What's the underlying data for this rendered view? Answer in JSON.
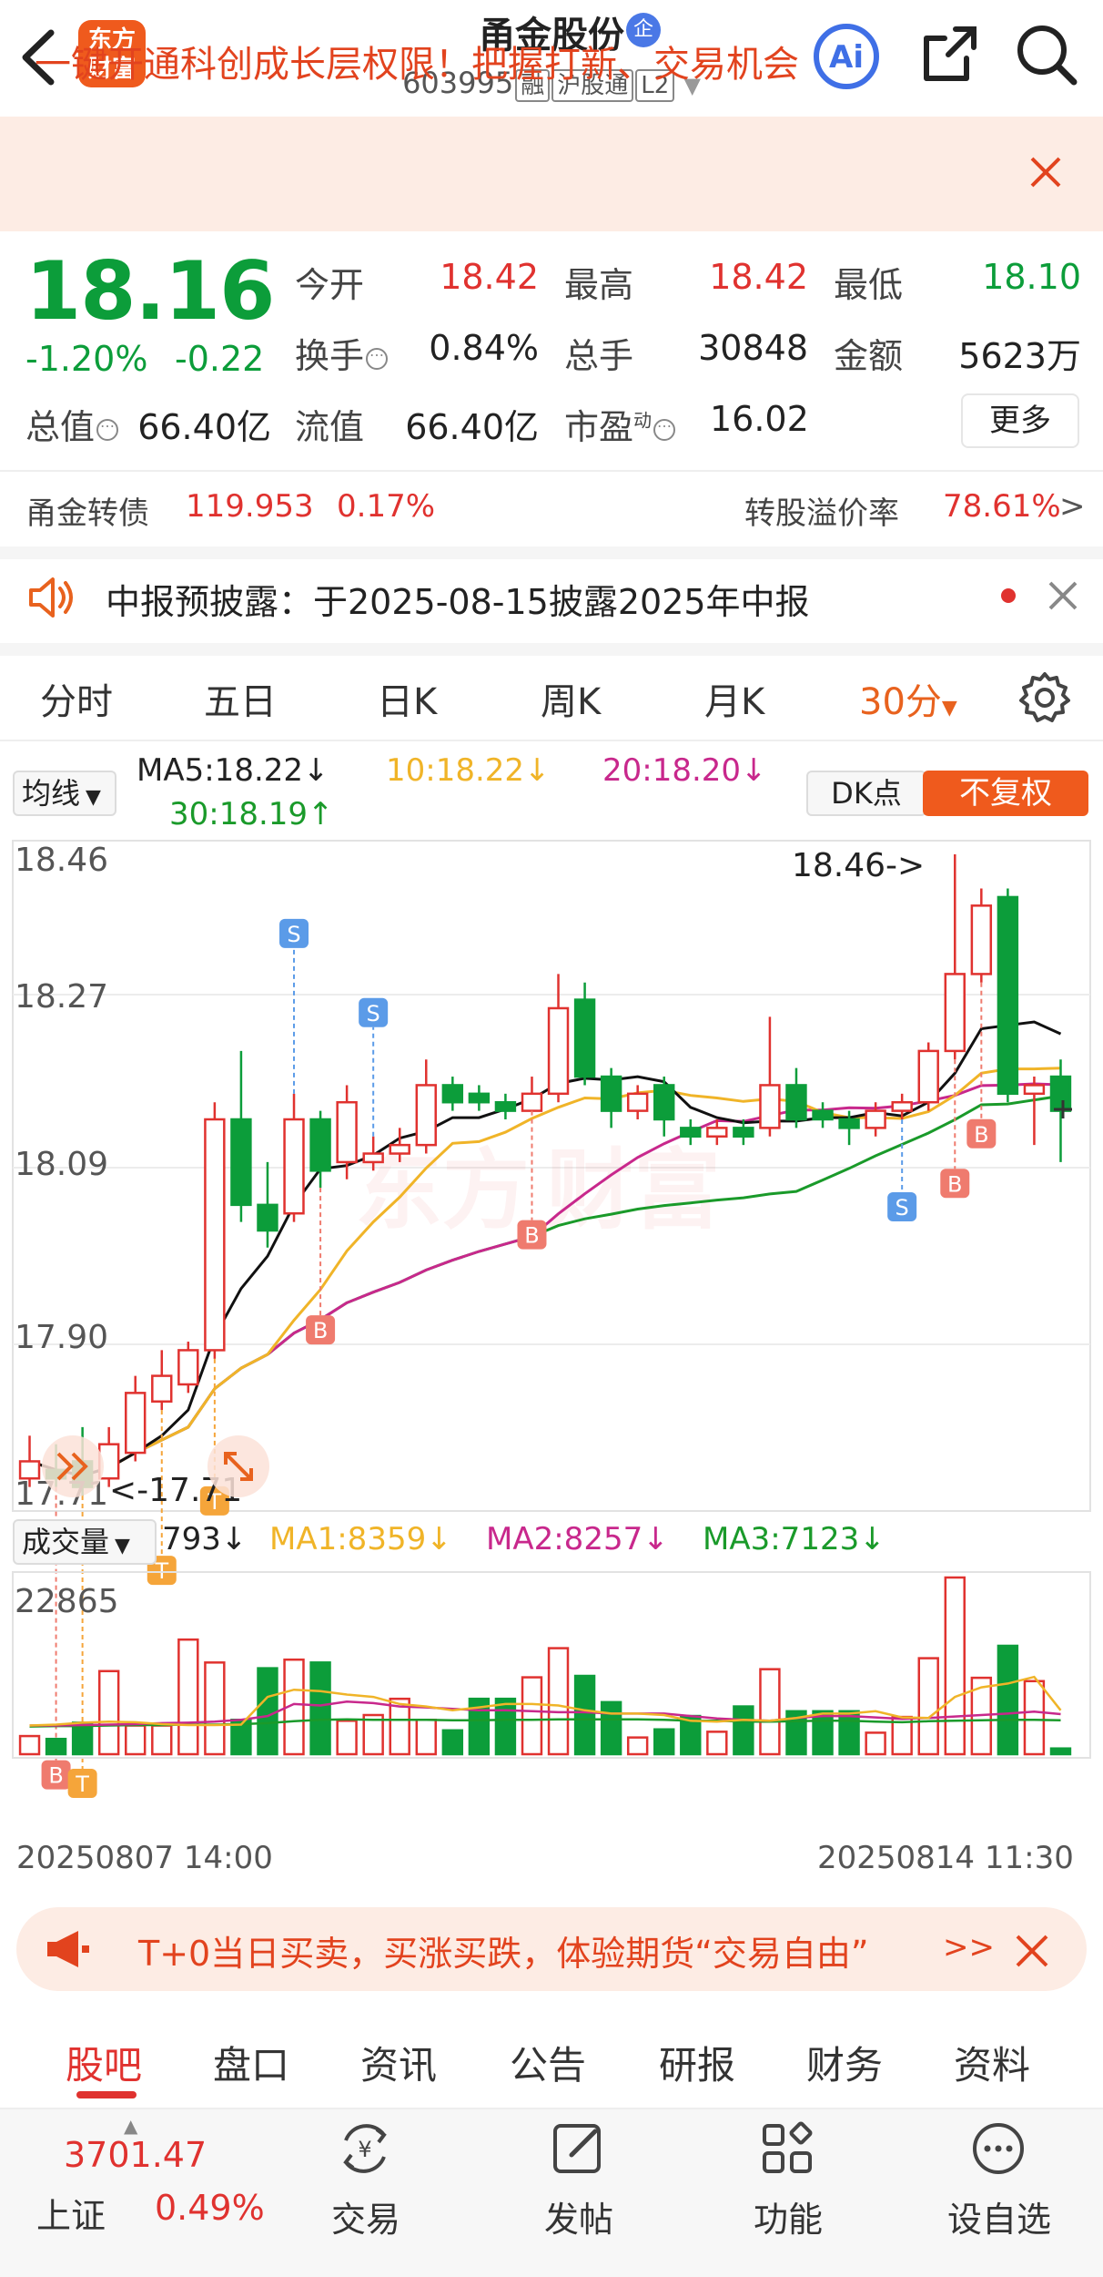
{
  "header": {
    "logo": [
      "东方",
      "财富"
    ],
    "stock_name": "甬金股份",
    "qi_badge": "企",
    "code": "603995",
    "tags": [
      "融",
      "沪股通",
      "L2"
    ],
    "ai_label": "Ai"
  },
  "banner": {
    "text": "一键开通科创成长层权限！把握打新、交易机会"
  },
  "quote": {
    "price": "18.16",
    "change_pct": "-1.20%",
    "change_abs": "-0.22",
    "fields": [
      {
        "label": "今开",
        "value": "18.42",
        "color": "red"
      },
      {
        "label": "最高",
        "value": "18.42",
        "color": "red"
      },
      {
        "label": "最低",
        "value": "18.10",
        "color": "green"
      },
      {
        "label": "换手",
        "value": "0.84%",
        "color": "dark"
      },
      {
        "label": "总手",
        "value": "30848",
        "color": "dark"
      },
      {
        "label": "金额",
        "value": "5623万",
        "color": "dark"
      },
      {
        "label": "总值",
        "value": "66.40亿",
        "color": "dark"
      },
      {
        "label": "流值",
        "value": "66.40亿",
        "color": "dark"
      },
      {
        "label": "市盈",
        "value": "16.02",
        "color": "dark"
      }
    ],
    "pe_superscript": "动",
    "more_label": "更多"
  },
  "bond": {
    "label": "甬金转债",
    "price": "119.953",
    "pct": "0.17%",
    "premium_label": "转股溢价率",
    "premium_value": "78.61%",
    "arrow": ">"
  },
  "notice": {
    "text": "中报预披露：于2025-08-15披露2025年中报"
  },
  "period_tabs": [
    "分时",
    "五日",
    "日K",
    "周K",
    "月K",
    "30分"
  ],
  "active_period": "30分",
  "ma_bar": {
    "select": "均线",
    "ma5": "MA5:18.22↓",
    "ma10": "10:18.22↓",
    "ma20": "20:18.20↓",
    "ma30": "30:18.19↑",
    "dk": "DK点",
    "fq": "不复权"
  },
  "chart_labels": {
    "y_ticks": [
      "18.46",
      "18.27",
      "18.09",
      "17.90",
      "17.71"
    ],
    "high_marker": "18.46->",
    "low_marker": "<-17.71",
    "volume_max": "22865"
  },
  "volume_bar": {
    "select": "成交量",
    "current": "793↓",
    "ma1": "MA1:8359↓",
    "ma2": "MA2:8257↓",
    "ma3": "MA3:7123↓"
  },
  "dates": {
    "start": "20250807 14:00",
    "end": "20250814 11:30"
  },
  "ad": {
    "text": "T+0当日买卖，买涨买跌，体验期货“交易自由”",
    "more": ">>"
  },
  "bottom_tabs": [
    "股吧",
    "盘口",
    "资讯",
    "公告",
    "研报",
    "财务",
    "资料"
  ],
  "active_bottom_tab": "股吧",
  "toolbar": {
    "index_value": "3701.47",
    "index_name": "上证",
    "index_pct": "0.49%",
    "items": [
      "交易",
      "发帖",
      "功能",
      "设自选"
    ]
  },
  "colors": {
    "up": "#e0322f",
    "down": "#0c9d3a",
    "accent": "#ef5a1d",
    "ma5": "#111111",
    "ma10": "#f0b428",
    "ma20": "#c8288c",
    "ma30": "#1a9a2a"
  },
  "chart_data": {
    "type": "candlestick",
    "interval": "30min",
    "ylim": [
      17.71,
      18.46
    ],
    "candles": [
      {
        "o": 17.73,
        "c": 17.75,
        "h": 17.78,
        "l": 17.72
      },
      {
        "o": 17.74,
        "c": 17.73,
        "h": 17.77,
        "l": 17.72
      },
      {
        "o": 17.75,
        "c": 17.72,
        "h": 17.79,
        "l": 17.71
      },
      {
        "o": 17.73,
        "c": 17.77,
        "h": 17.79,
        "l": 17.72
      },
      {
        "o": 17.76,
        "c": 17.83,
        "h": 17.85,
        "l": 17.75
      },
      {
        "o": 17.82,
        "c": 17.85,
        "h": 17.88,
        "l": 17.81
      },
      {
        "o": 17.84,
        "c": 17.88,
        "h": 17.89,
        "l": 17.83
      },
      {
        "o": 17.88,
        "c": 18.15,
        "h": 18.17,
        "l": 17.87
      },
      {
        "o": 18.15,
        "c": 18.05,
        "h": 18.23,
        "l": 18.03
      },
      {
        "o": 18.05,
        "c": 18.02,
        "h": 18.1,
        "l": 18.0
      },
      {
        "o": 18.04,
        "c": 18.15,
        "h": 18.18,
        "l": 18.03
      },
      {
        "o": 18.15,
        "c": 18.09,
        "h": 18.16,
        "l": 18.07
      },
      {
        "o": 18.1,
        "c": 18.17,
        "h": 18.19,
        "l": 18.08
      },
      {
        "o": 18.1,
        "c": 18.11,
        "h": 18.13,
        "l": 18.09
      },
      {
        "o": 18.11,
        "c": 18.12,
        "h": 18.14,
        "l": 18.1
      },
      {
        "o": 18.12,
        "c": 18.19,
        "h": 18.22,
        "l": 18.11
      },
      {
        "o": 18.19,
        "c": 18.17,
        "h": 18.2,
        "l": 18.16
      },
      {
        "o": 18.18,
        "c": 18.17,
        "h": 18.19,
        "l": 18.16
      },
      {
        "o": 18.17,
        "c": 18.16,
        "h": 18.18,
        "l": 18.15
      },
      {
        "o": 18.16,
        "c": 18.18,
        "h": 18.2,
        "l": 18.16
      },
      {
        "o": 18.18,
        "c": 18.28,
        "h": 18.32,
        "l": 18.17
      },
      {
        "o": 18.29,
        "c": 18.2,
        "h": 18.31,
        "l": 18.19
      },
      {
        "o": 18.2,
        "c": 18.16,
        "h": 18.21,
        "l": 18.14
      },
      {
        "o": 18.16,
        "c": 18.18,
        "h": 18.19,
        "l": 18.15
      },
      {
        "o": 18.19,
        "c": 18.15,
        "h": 18.2,
        "l": 18.13
      },
      {
        "o": 18.14,
        "c": 18.13,
        "h": 18.15,
        "l": 18.12
      },
      {
        "o": 18.13,
        "c": 18.14,
        "h": 18.15,
        "l": 18.12
      },
      {
        "o": 18.14,
        "c": 18.13,
        "h": 18.15,
        "l": 18.12
      },
      {
        "o": 18.14,
        "c": 18.19,
        "h": 18.27,
        "l": 18.13
      },
      {
        "o": 18.19,
        "c": 18.15,
        "h": 18.21,
        "l": 18.14
      },
      {
        "o": 18.16,
        "c": 18.15,
        "h": 18.17,
        "l": 18.14
      },
      {
        "o": 18.15,
        "c": 18.14,
        "h": 18.16,
        "l": 18.12
      },
      {
        "o": 18.14,
        "c": 18.16,
        "h": 18.17,
        "l": 18.13
      },
      {
        "o": 18.16,
        "c": 18.17,
        "h": 18.18,
        "l": 18.15
      },
      {
        "o": 18.17,
        "c": 18.23,
        "h": 18.24,
        "l": 18.16
      },
      {
        "o": 18.23,
        "c": 18.32,
        "h": 18.46,
        "l": 18.22
      },
      {
        "o": 18.32,
        "c": 18.4,
        "h": 18.42,
        "l": 18.31
      },
      {
        "o": 18.41,
        "c": 18.18,
        "h": 18.42,
        "l": 18.17
      },
      {
        "o": 18.18,
        "c": 18.19,
        "h": 18.2,
        "l": 18.12
      },
      {
        "o": 18.2,
        "c": 18.16,
        "h": 18.22,
        "l": 18.1
      }
    ],
    "volume": [
      3800,
      3200,
      6600,
      17400,
      6000,
      6000,
      24000,
      19200,
      7200,
      18000,
      19800,
      19200,
      7000,
      8200,
      11600,
      7200,
      5000,
      11600,
      11600,
      16100,
      22200,
      16400,
      10900,
      3500,
      5200,
      8000,
      4700,
      10000,
      17800,
      9000,
      9000,
      9000,
      4500,
      7800,
      20100,
      37000,
      16000,
      22700,
      15300,
      1200
    ],
    "ma1": [
      6000,
      6200,
      6600,
      6800,
      6700,
      6300,
      6100,
      6100,
      6200,
      12000,
      13500,
      13200,
      12500,
      12000,
      10500,
      10000,
      9200,
      9800,
      10500,
      10500,
      10200,
      9200,
      8500,
      8500,
      8200,
      7000,
      6800,
      7200,
      7000,
      7600,
      8500,
      8500,
      9000,
      7700,
      7600,
      12000,
      14000,
      14800,
      16200,
      9200
    ],
    "ma2": [
      6000,
      6000,
      6100,
      6200,
      6300,
      6500,
      6600,
      6800,
      7200,
      8000,
      10500,
      10200,
      11000,
      10700,
      10000,
      9800,
      9500,
      9200,
      9200,
      9000,
      8800,
      8800,
      8500,
      8500,
      8500,
      8000,
      7500,
      7200,
      7000,
      7600,
      8000,
      8000,
      7700,
      7400,
      7600,
      7900,
      8200,
      8500,
      8900,
      8400
    ],
    "ma3": [
      5800,
      5900,
      5900,
      6000,
      6100,
      6100,
      6200,
      6200,
      6300,
      6500,
      6900,
      7200,
      7300,
      7200,
      7200,
      7200,
      7100,
      7100,
      7200,
      7200,
      7300,
      7300,
      7300,
      7300,
      7200,
      7000,
      7000,
      6800,
      6800,
      6900,
      7000,
      7000,
      6800,
      6700,
      6900,
      7000,
      7100,
      7200,
      7200,
      7100
    ]
  }
}
